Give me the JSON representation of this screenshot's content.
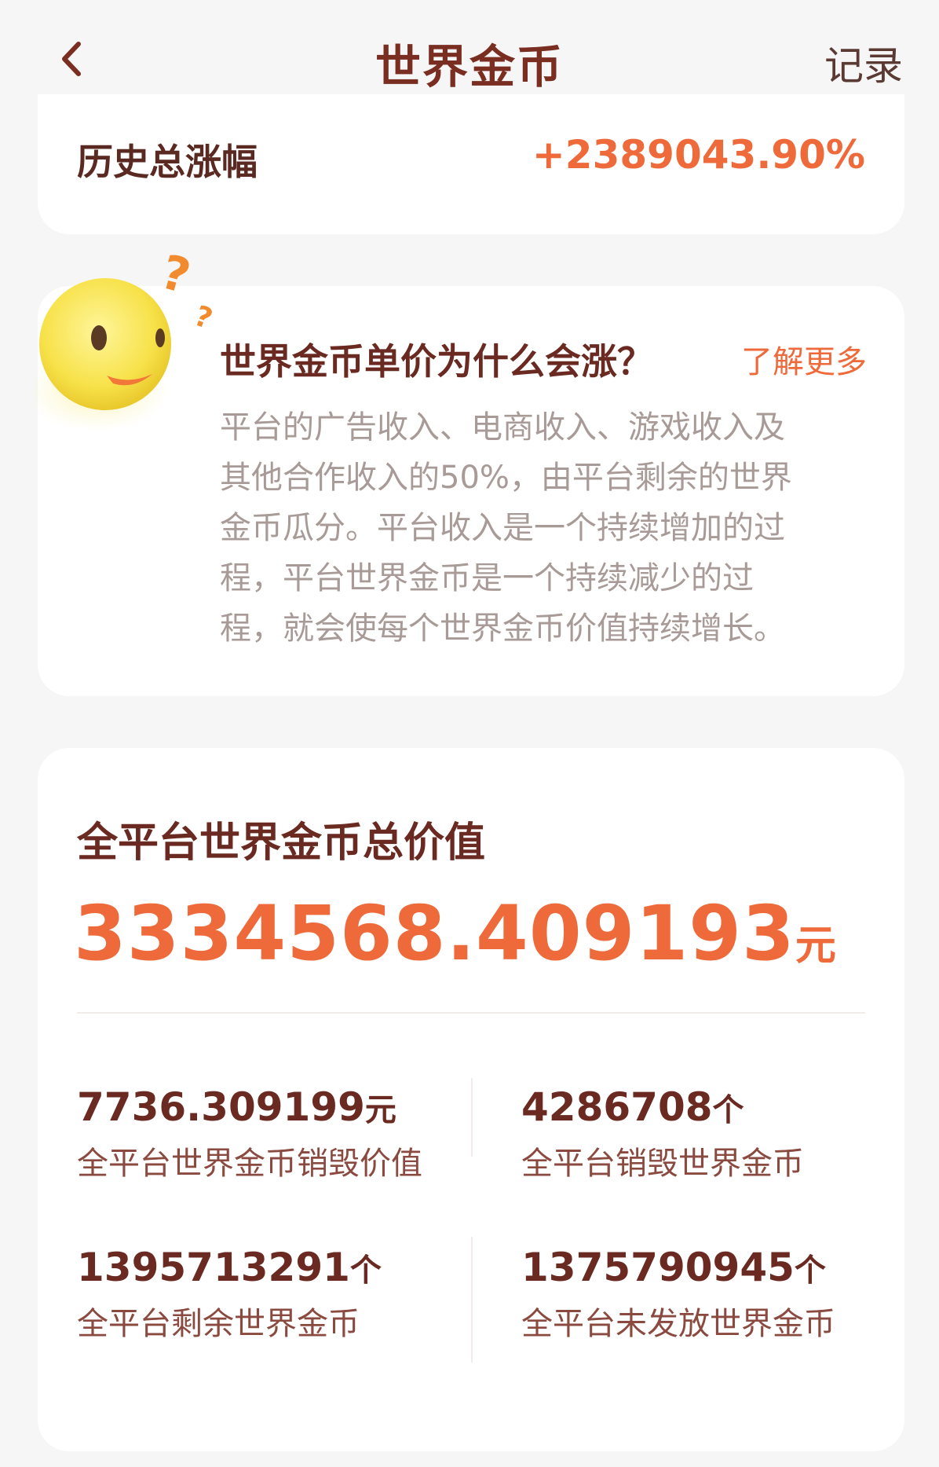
{
  "header": {
    "title": "世界金币",
    "record_label": "记录"
  },
  "history": {
    "label": "历史总涨幅",
    "value": "+2389043.90%"
  },
  "why": {
    "title": "世界金币单价为什么会涨？",
    "more_label": "了解更多",
    "lines": [
      "平台的广告收入、电商收入、游戏收入及",
      "其他合作收入的50%，由平台剩余的世界",
      "金币瓜分。平台收入是一个持续增加的过",
      "程，平台世界金币是一个持续减少的过",
      "程，就会使每个世界金币价值持续增长。"
    ]
  },
  "total": {
    "label": "全平台世界金币总价值",
    "value": "3334568.409193",
    "unit": "元"
  },
  "stats": [
    {
      "value": "7736.309199",
      "unit": "元",
      "label": "全平台世界金币销毁价值"
    },
    {
      "value": "4286708",
      "unit": "个",
      "label": "全平台销毁世界金币"
    },
    {
      "value": "1395713291",
      "unit": "个",
      "label": "全平台剩余世界金币"
    },
    {
      "value": "1375790945",
      "unit": "个",
      "label": "全平台未发放世界金币"
    }
  ],
  "colors": {
    "accent": "#ef6a3a",
    "title": "#7a2e22",
    "card": "#ffffff",
    "background": "#f6f6f6"
  }
}
